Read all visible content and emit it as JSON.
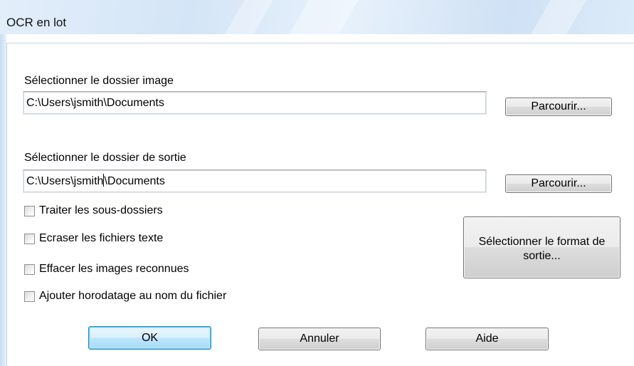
{
  "window": {
    "title": "OCR en lot"
  },
  "image_folder": {
    "label": "Sélectionner le dossier image",
    "value": "C:\\Users\\jsmith\\Documents",
    "browse_label": "Parcourir..."
  },
  "output_folder": {
    "label": "Sélectionner le dossier de sortie",
    "value_before_caret": "C:\\Users\\jsmith",
    "value_after_caret": "\\Documents",
    "browse_label": "Parcourir..."
  },
  "options": [
    {
      "label": "Traiter les sous-dossiers",
      "checked": false
    },
    {
      "label": "Ecraser les fichiers texte",
      "checked": false
    },
    {
      "label": "Effacer les images reconnues",
      "checked": false
    },
    {
      "label": "Ajouter horodatage au nom du fichier",
      "checked": false
    }
  ],
  "format_button": {
    "label_line1": "Sélectionner le format de",
    "label_line2": "sortie..."
  },
  "footer": {
    "ok_label": "OK",
    "cancel_label": "Annuler",
    "help_label": "Aide"
  },
  "colors": {
    "titlebar": "#dcebf9",
    "default_button_border": "#3c7fb1",
    "field_border": "#abadb3"
  }
}
